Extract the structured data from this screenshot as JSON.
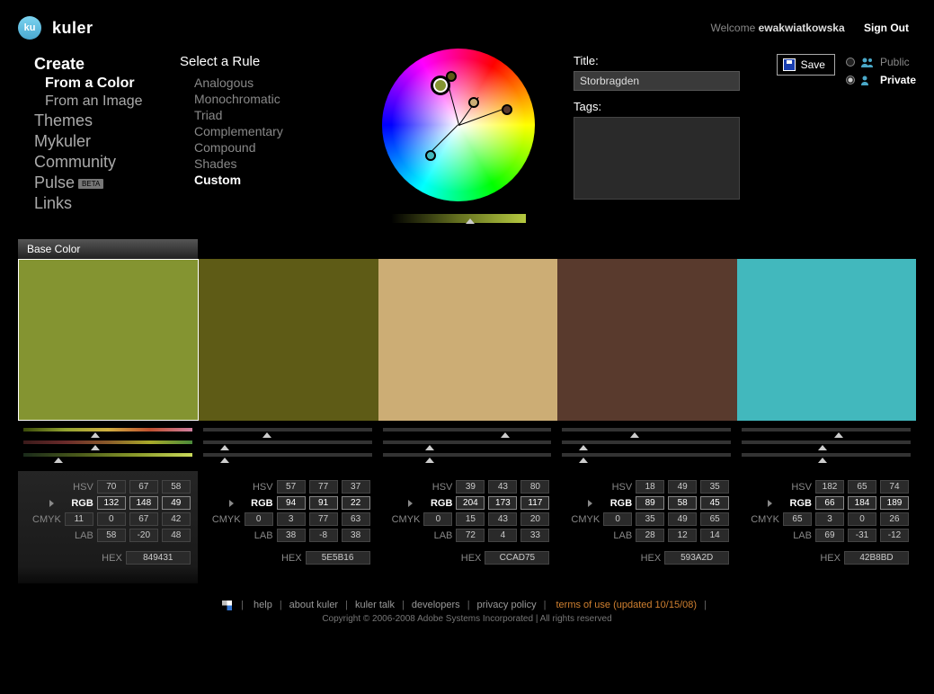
{
  "header": {
    "logo_badge": "ku",
    "logo_text": "kuler",
    "welcome": "Welcome",
    "username": "ewakwiatkowska",
    "signout": "Sign Out"
  },
  "nav": [
    {
      "label": "Create",
      "lvl": 1,
      "active": true
    },
    {
      "label": "From a Color",
      "lvl": 2,
      "active": true
    },
    {
      "label": "From an Image",
      "lvl": 2,
      "active": false
    },
    {
      "label": "Themes",
      "lvl": 1,
      "active": false
    },
    {
      "label": "Mykuler",
      "lvl": 1,
      "active": false
    },
    {
      "label": "Community",
      "lvl": 1,
      "active": false
    },
    {
      "label": "Pulse",
      "lvl": 1,
      "active": false,
      "beta": true
    },
    {
      "label": "Links",
      "lvl": 1,
      "active": false
    }
  ],
  "rules": {
    "title": "Select a Rule",
    "items": [
      {
        "label": "Analogous",
        "active": false
      },
      {
        "label": "Monochromatic",
        "active": false
      },
      {
        "label": "Triad",
        "active": false
      },
      {
        "label": "Complementary",
        "active": false
      },
      {
        "label": "Compound",
        "active": false
      },
      {
        "label": "Shades",
        "active": false
      },
      {
        "label": "Custom",
        "active": true
      }
    ]
  },
  "meta": {
    "title_label": "Title:",
    "title_value": "Storbragden",
    "tags_label": "Tags:",
    "save_label": "Save",
    "visibility": [
      {
        "label": "Public",
        "on": false,
        "icon": "group-icon",
        "color": "#4aa8c8"
      },
      {
        "label": "Private",
        "on": true,
        "icon": "person-icon",
        "color": "#4aa8c8"
      }
    ]
  },
  "base_tab": "Base Color",
  "swatches": [
    {
      "hex": "849431",
      "base": true,
      "HSV": [
        "70",
        "67",
        "58"
      ],
      "RGB": [
        "132",
        "148",
        "49"
      ],
      "CMYK": [
        "11",
        "0",
        "67",
        "42"
      ],
      "LAB": [
        "58",
        "-20",
        "48"
      ],
      "HEX": "849431",
      "tri": [
        40,
        40,
        18
      ]
    },
    {
      "hex": "5E5B16",
      "base": false,
      "HSV": [
        "57",
        "77",
        "37"
      ],
      "RGB": [
        "94",
        "91",
        "22"
      ],
      "CMYK": [
        "0",
        "3",
        "77",
        "63"
      ],
      "LAB": [
        "38",
        "-8",
        "38"
      ],
      "HEX": "5E5B16",
      "tri": [
        35,
        10,
        10
      ]
    },
    {
      "hex": "CCAD75",
      "base": false,
      "HSV": [
        "39",
        "43",
        "80"
      ],
      "RGB": [
        "204",
        "173",
        "117"
      ],
      "CMYK": [
        "0",
        "15",
        "43",
        "20"
      ],
      "LAB": [
        "72",
        "4",
        "33"
      ],
      "HEX": "CCAD75",
      "tri": [
        70,
        25,
        25
      ]
    },
    {
      "hex": "593A2D",
      "base": false,
      "HSV": [
        "18",
        "49",
        "35"
      ],
      "RGB": [
        "89",
        "58",
        "45"
      ],
      "CMYK": [
        "0",
        "35",
        "49",
        "65"
      ],
      "LAB": [
        "28",
        "12",
        "14"
      ],
      "HEX": "593A2D",
      "tri": [
        40,
        10,
        10
      ]
    },
    {
      "hex": "42B8BD",
      "base": false,
      "HSV": [
        "182",
        "65",
        "74"
      ],
      "RGB": [
        "66",
        "184",
        "189"
      ],
      "CMYK": [
        "65",
        "3",
        "0",
        "26"
      ],
      "LAB": [
        "69",
        "-31",
        "-12"
      ],
      "HEX": "42B8BD",
      "tri": [
        55,
        45,
        45
      ]
    }
  ],
  "val_labels": {
    "HSV": "HSV",
    "RGB": "RGB",
    "CMYK": "CMYK",
    "LAB": "LAB",
    "HEX": "HEX"
  },
  "footer": {
    "links": [
      "help",
      "about kuler",
      "kuler talk",
      "developers",
      "privacy policy"
    ],
    "terms": "terms of use (updated 10/15/08)",
    "copy": "Copyright © 2006-2008 Adobe Systems Incorporated | All rights reserved"
  }
}
